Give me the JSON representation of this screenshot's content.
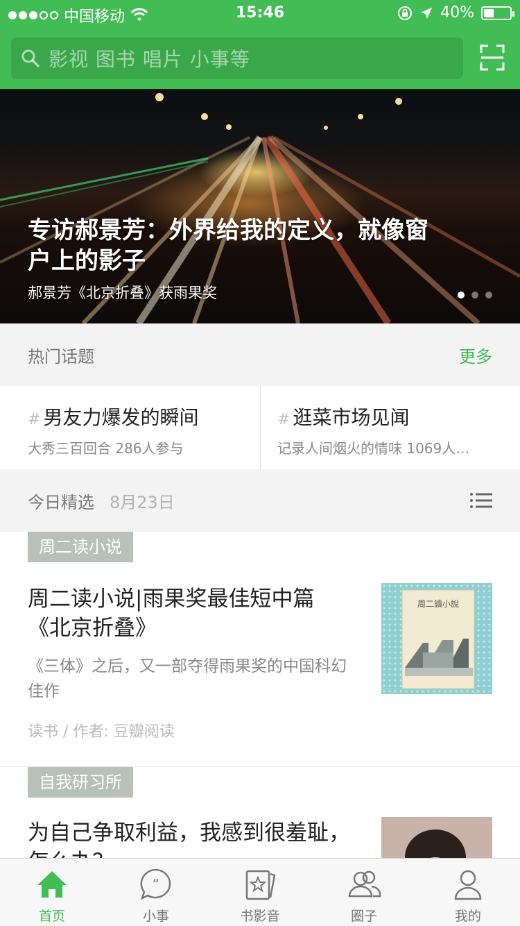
{
  "status_bar": {
    "carrier": "中国移动",
    "time": "15:46",
    "battery": "40%"
  },
  "search": {
    "placeholder": "影视 图书 唱片 小事等"
  },
  "banner": {
    "title": "专访郝景芳：外界给我的定义，就像窗户上的影子",
    "subtitle": "郝景芳《北京折叠》获雨果奖",
    "pages": 3,
    "active_page": 1
  },
  "hot_topics": {
    "label": "热门话题",
    "more": "更多",
    "items": [
      {
        "hash": "#",
        "title": "男友力爆发的瞬间",
        "sub": "大秀三百回合 286人参与"
      },
      {
        "hash": "#",
        "title": "逛菜市场见闻",
        "sub": "记录人间烟火的情味 1069人…"
      }
    ]
  },
  "today": {
    "label": "今日精选",
    "date": "8月23日"
  },
  "cards": [
    {
      "tag": "周二读小说",
      "title": "周二读小说|雨果奖最佳短中篇《北京折叠》",
      "desc": "《三体》之后，又一部夺得雨果奖的中国科幻佳作",
      "meta": "读书 / 作者: 豆瓣阅读",
      "thumb_text": "周二讀小說"
    },
    {
      "tag": "自我研习所",
      "title": "为自己争取利益，我感到很羞耻，怎么办？"
    }
  ],
  "tabs": [
    {
      "label": "首页",
      "icon": "home-icon",
      "active": true
    },
    {
      "label": "小事",
      "icon": "chat-quote-icon",
      "active": false
    },
    {
      "label": "书影音",
      "icon": "star-card-icon",
      "active": false
    },
    {
      "label": "圈子",
      "icon": "group-icon",
      "active": false
    },
    {
      "label": "我的",
      "icon": "person-icon",
      "active": false
    }
  ],
  "colors": {
    "brand_green": "#42bd56",
    "tag_gray": "#b7c1ba"
  }
}
